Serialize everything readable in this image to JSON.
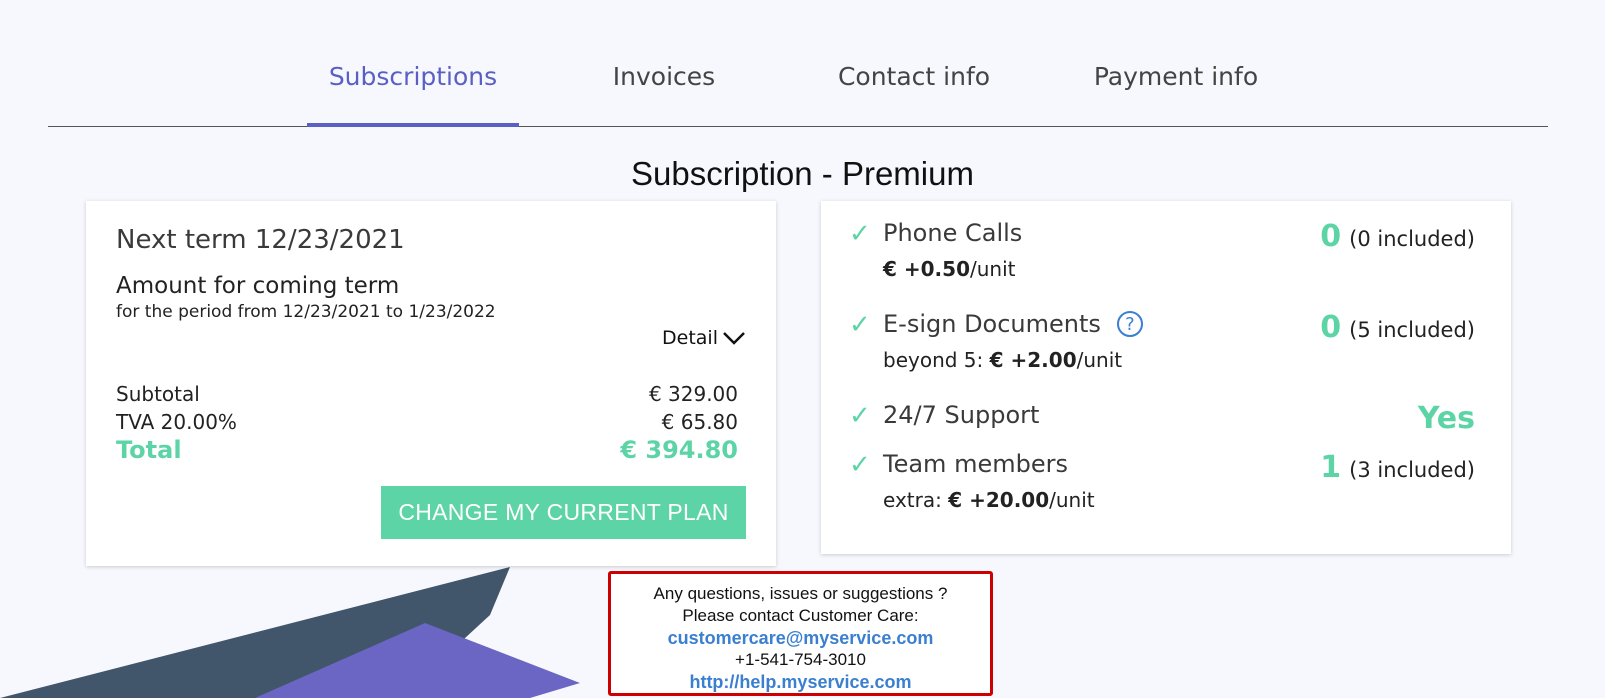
{
  "tabs": [
    {
      "label": "Subscriptions",
      "active": true
    },
    {
      "label": "Invoices",
      "active": false
    },
    {
      "label": "Contact info",
      "active": false
    },
    {
      "label": "Payment info",
      "active": false
    }
  ],
  "page_title": "Subscription - Premium",
  "term": {
    "next_term": "Next term 12/23/2021",
    "amount_title": "Amount for coming term",
    "period": "for the period from 12/23/2021 to 1/23/2022",
    "detail_label": "Detail",
    "subtotal_label": "Subtotal",
    "subtotal_value": "€ 329.00",
    "tax_label": "TVA 20.00%",
    "tax_value": "€ 65.80",
    "total_label": "Total",
    "total_value": "€ 394.80",
    "change_button": "CHANGE MY CURRENT PLAN"
  },
  "features": [
    {
      "name": "Phone Calls",
      "value": "0",
      "included": "(0 included)",
      "sub_prefix": "",
      "sub_price": "€ +0.50",
      "sub_suffix": "/unit"
    },
    {
      "name": "E-sign Documents",
      "value": "0",
      "included": "(5 included)",
      "sub_prefix": "beyond 5: ",
      "sub_price": "€ +2.00",
      "sub_suffix": "/unit"
    },
    {
      "name": "24/7 Support",
      "value": "Yes"
    },
    {
      "name": "Team members",
      "value": "1",
      "included": "(3 included)",
      "sub_prefix": "extra: ",
      "sub_price": "€ +20.00",
      "sub_suffix": "/unit"
    }
  ],
  "contact": {
    "line1": "Any questions, issues or suggestions ?",
    "line2": "Please contact Customer Care:",
    "email": "customercare@myservice.com",
    "phone": "+1-541-754-3010",
    "url": "http://help.myservice.com"
  },
  "icons": {
    "check": "check-icon",
    "help": "help-circle-icon",
    "chevron": "chevron-down-icon"
  },
  "colors": {
    "accent": "#5a5fc4",
    "green": "#5dd4a6",
    "link": "#3a7fd0",
    "highlight": "#cc0000"
  }
}
